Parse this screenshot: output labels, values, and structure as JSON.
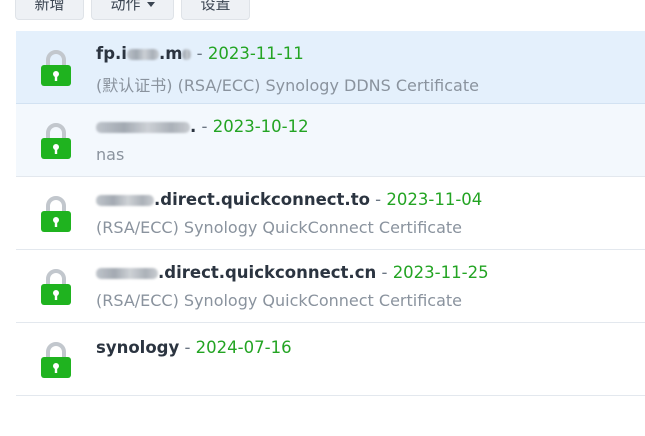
{
  "toolbar": {
    "add_label": "新增",
    "action_label": "动作",
    "settings_label": "设置"
  },
  "colors": {
    "date_green": "#23a423",
    "lock_green": "#1fb31f",
    "selected_row_bg": "#e4f0fc"
  },
  "certificates": [
    {
      "name_prefix": "f",
      "name_suffix": "p.i",
      "name_tail": ".m",
      "date": "2023-11-11",
      "description": "(默认证书) (RSA/ECC) Synology DDNS Certificate",
      "icon": "lock-icon",
      "state": "selected"
    },
    {
      "name_prefix": "",
      "name_suffix": "",
      "name_tail": ".",
      "date": "2023-10-12",
      "description": "nas",
      "icon": "lock-icon",
      "state": "hover"
    },
    {
      "name_prefix": "",
      "name_suffix": "",
      "name_tail": ".direct.quickconnect.to",
      "date": "2023-11-04",
      "description": "(RSA/ECC) Synology QuickConnect Certificate",
      "icon": "lock-icon",
      "state": ""
    },
    {
      "name_prefix": "",
      "name_suffix": "",
      "name_tail": ".direct.quickconnect.cn",
      "date": "2023-11-25",
      "description": "(RSA/ECC) Synology QuickConnect Certificate",
      "icon": "lock-icon",
      "state": ""
    },
    {
      "name_prefix": "",
      "name_suffix": "",
      "name_tail": "synology",
      "date": "2024-07-16",
      "description": "",
      "icon": "lock-icon",
      "state": ""
    }
  ],
  "separator": " - "
}
